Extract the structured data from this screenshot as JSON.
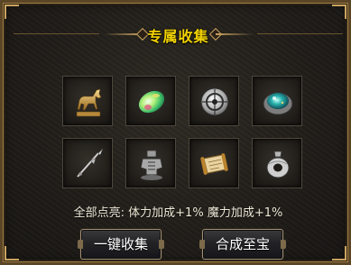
{
  "panel": {
    "title": "专属收集"
  },
  "slots": [
    {
      "name": "golden-horse-icon"
    },
    {
      "name": "jade-orb-icon"
    },
    {
      "name": "silver-disc-icon"
    },
    {
      "name": "teal-gem-plate-icon"
    },
    {
      "name": "silver-spear-icon"
    },
    {
      "name": "silver-armor-icon"
    },
    {
      "name": "scroll-icon"
    },
    {
      "name": "silver-pendant-icon"
    }
  ],
  "bonus": {
    "label": "全部点亮:",
    "stat1": "体力加成+1%",
    "stat2": "魔力加成+1%"
  },
  "buttons": {
    "collect_all": "一键收集",
    "synthesize": "合成至宝"
  },
  "colors": {
    "title": "#f2d200",
    "frame_gold": "#c9a35e",
    "text": "#f0ead8"
  }
}
